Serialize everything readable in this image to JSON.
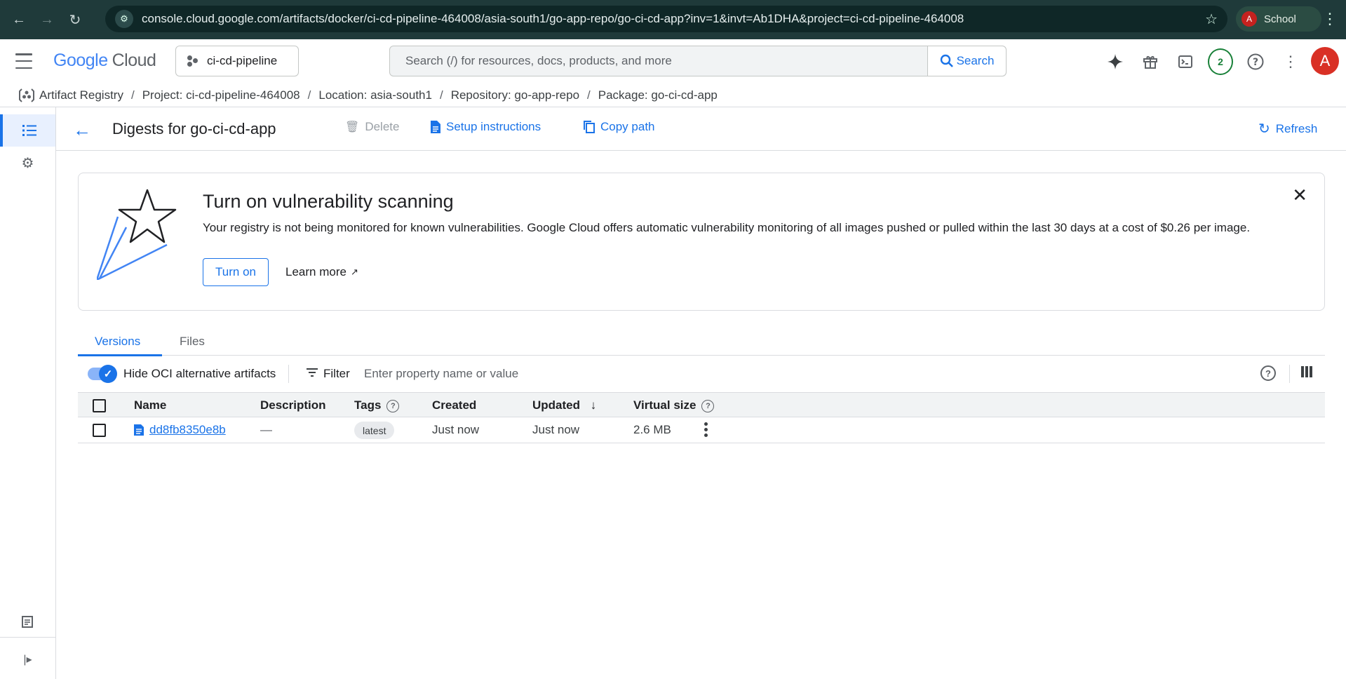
{
  "browser": {
    "url": "console.cloud.google.com/artifacts/docker/ci-cd-pipeline-464008/asia-south1/go-app-repo/go-ci-cd-app?inv=1&invt=Ab1DHA&project=ci-cd-pipeline-464008",
    "profile_initial": "A",
    "profile_name": "School"
  },
  "header": {
    "logo_google": "Google",
    "logo_cloud": "Cloud",
    "project": "ci-cd-pipeline",
    "search_placeholder": "Search (/) for resources, docs, products, and more",
    "search_button": "Search",
    "notifications_count": "2",
    "user_initial": "A"
  },
  "breadcrumb": {
    "items": [
      "Artifact Registry",
      "Project: ci-cd-pipeline-464008",
      "Location: asia-south1",
      "Repository: go-app-repo",
      "Package: go-ci-cd-app"
    ],
    "separator": "/"
  },
  "toolbar": {
    "title": "Digests for go-ci-cd-app",
    "delete": "Delete",
    "setup": "Setup instructions",
    "copy_path": "Copy path",
    "refresh": "Refresh"
  },
  "banner": {
    "title": "Turn on vulnerability scanning",
    "description": "Your registry is not being monitored for known vulnerabilities. Google Cloud offers automatic vulnerability monitoring of all images pushed or pulled within the last 30 days at a cost of $0.26 per image.",
    "turn_on": "Turn on",
    "learn_more": "Learn more"
  },
  "tabs": [
    "Versions",
    "Files"
  ],
  "filter": {
    "toggle_label": "Hide OCI alternative artifacts",
    "filter_label": "Filter",
    "placeholder": "Enter property name or value"
  },
  "table": {
    "columns": [
      "Name",
      "Description",
      "Tags",
      "Created",
      "Updated",
      "Virtual size"
    ],
    "rows": [
      {
        "name": "dd8fb8350e8b",
        "description": "—",
        "tag": "latest",
        "created": "Just now",
        "updated": "Just now",
        "size": "2.6 MB"
      }
    ]
  },
  "colors": {
    "accent": "#1a73e8",
    "browser_bar": "#1f3a3a"
  }
}
